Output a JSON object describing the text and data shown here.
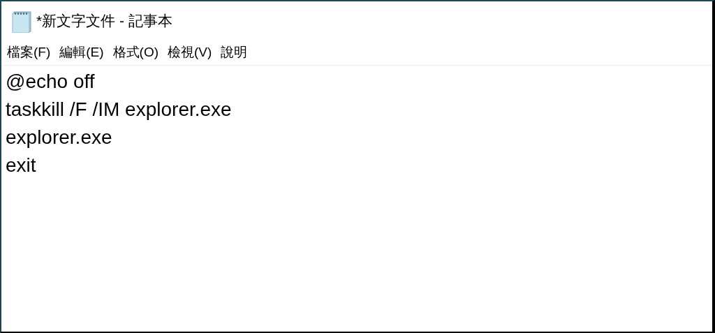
{
  "window": {
    "title": "*新文字文件 - 記事本"
  },
  "menu": [
    "檔案(F)",
    "編輯(E)",
    "格式(O)",
    "檢視(V)",
    "說明"
  ],
  "editor": {
    "lines": [
      "@echo off",
      "taskkill /F /IM explorer.exe",
      "explorer.exe",
      "exit"
    ]
  }
}
